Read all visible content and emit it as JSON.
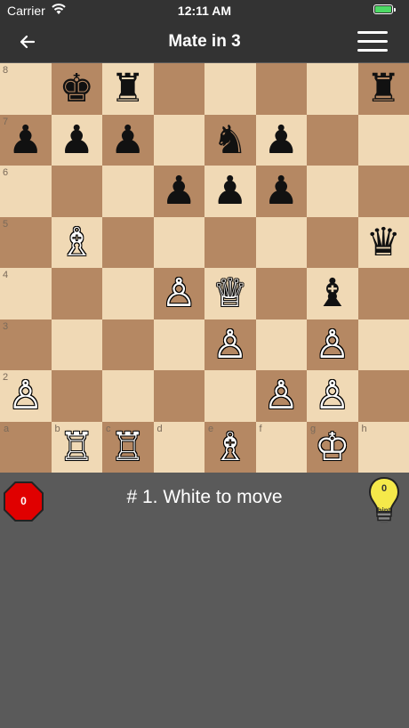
{
  "status_bar": {
    "carrier": "Carrier",
    "time": "12:11 AM",
    "battery_level": 1.0
  },
  "nav": {
    "title": "Mate in 3",
    "back_icon": "back-arrow-icon",
    "menu_icon": "hamburger-menu-icon"
  },
  "board": {
    "light_color": "#f0d9b5",
    "dark_color": "#b58863",
    "rank_labels": [
      "8",
      "7",
      "6",
      "5",
      "4",
      "3",
      "2"
    ],
    "file_labels": [
      "a",
      "b",
      "c",
      "d",
      "e",
      "f",
      "g",
      "h"
    ],
    "pieces": [
      {
        "square": "b8",
        "color": "black",
        "type": "king"
      },
      {
        "square": "c8",
        "color": "black",
        "type": "rook"
      },
      {
        "square": "h8",
        "color": "black",
        "type": "rook"
      },
      {
        "square": "a7",
        "color": "black",
        "type": "pawn"
      },
      {
        "square": "b7",
        "color": "black",
        "type": "pawn"
      },
      {
        "square": "c7",
        "color": "black",
        "type": "pawn"
      },
      {
        "square": "e7",
        "color": "black",
        "type": "knight"
      },
      {
        "square": "f7",
        "color": "black",
        "type": "pawn"
      },
      {
        "square": "d6",
        "color": "black",
        "type": "pawn"
      },
      {
        "square": "e6",
        "color": "black",
        "type": "pawn"
      },
      {
        "square": "f6",
        "color": "black",
        "type": "pawn"
      },
      {
        "square": "b5",
        "color": "white",
        "type": "bishop"
      },
      {
        "square": "h5",
        "color": "black",
        "type": "queen"
      },
      {
        "square": "d4",
        "color": "white",
        "type": "pawn"
      },
      {
        "square": "e4",
        "color": "white",
        "type": "queen"
      },
      {
        "square": "g4",
        "color": "black",
        "type": "bishop"
      },
      {
        "square": "e3",
        "color": "white",
        "type": "pawn"
      },
      {
        "square": "g3",
        "color": "white",
        "type": "pawn"
      },
      {
        "square": "a2",
        "color": "white",
        "type": "pawn"
      },
      {
        "square": "f2",
        "color": "white",
        "type": "pawn"
      },
      {
        "square": "g2",
        "color": "white",
        "type": "pawn"
      },
      {
        "square": "b1",
        "color": "white",
        "type": "rook"
      },
      {
        "square": "c1",
        "color": "white",
        "type": "rook"
      },
      {
        "square": "e1",
        "color": "white",
        "type": "bishop"
      },
      {
        "square": "g1",
        "color": "white",
        "type": "king"
      }
    ]
  },
  "info": {
    "mistakes_count": "0",
    "move_prompt": "# 1. White to move",
    "hint_count": "0",
    "hint_label": "hint",
    "stop_color": "#e00000",
    "bulb_color": "#f5e94a"
  }
}
